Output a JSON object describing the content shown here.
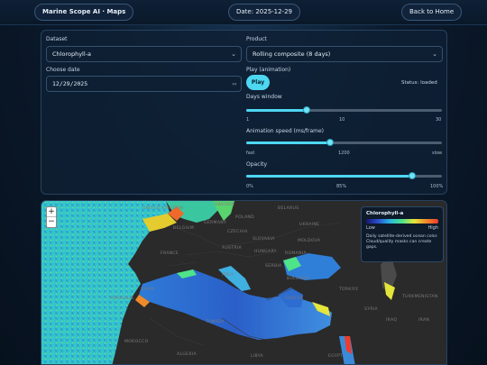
{
  "header": {
    "title": "Marine Scope AI · Maps",
    "date_label": "Date:",
    "date_value": "2025-12-29",
    "home_label": "Back to Home"
  },
  "controls": {
    "dataset": {
      "label": "Dataset",
      "value": "Chlorophyll-a"
    },
    "product": {
      "label": "Product",
      "value": "Rolling composite (8 days)"
    },
    "date": {
      "label": "Choose date",
      "value": "12/29/2025"
    },
    "play": {
      "label": "Play (animation)",
      "button": "Play",
      "status": "Status: loaded"
    },
    "days_window": {
      "label": "Days window",
      "value": 8,
      "min_label": "1",
      "mid_label": "10",
      "max_label": "30",
      "fraction": 0.31
    },
    "speed": {
      "label": "Animation speed (ms/frame)",
      "min_label": "fast",
      "mid_label": "1200",
      "max_label": "slow",
      "fraction": 0.43
    },
    "opacity": {
      "label": "Opacity",
      "min_label": "0%",
      "mid_label": "85%",
      "max_label": "100%",
      "fraction": 0.85
    }
  },
  "map": {
    "zoom_in": "+",
    "zoom_out": "−",
    "legend": {
      "title": "Chlorophyll-a",
      "low": "Low",
      "high": "High",
      "note": "Daily satellite-derived ocean color. Cloud/quality masks can create gaps."
    },
    "labels": {
      "sweden": "SWEDEN",
      "uk": "UNITED KINGDOM",
      "belarus": "BELARUS",
      "poland": "POLAND",
      "ukraine": "UKRAINE",
      "belgium": "BELGIUM",
      "germany": "GERMANY",
      "czechia": "CZECHIA",
      "slovakia": "SLOVAKIA",
      "moldova": "MOLDOVA",
      "france": "FRANCE",
      "austria": "AUSTRIA",
      "hungary": "HUNGARY",
      "romania": "ROMANIA",
      "italy": "ITALY",
      "serbia": "SERBIA",
      "bulgaria": "BULGARIA",
      "spain": "SPAIN",
      "portugal": "PORTUGAL",
      "greece": "GREECE",
      "turkey": "TÜRKIYE",
      "turkmenistan": "TURKMENISTAN",
      "syria": "SYRIA",
      "iraq": "IRAQ",
      "tunisia": "TUNISIA",
      "morocco": "MOROCCO",
      "algeria": "ALGERIA",
      "libya": "LIBYA",
      "egypt": "EGYPT",
      "iran": "IRAN"
    }
  }
}
